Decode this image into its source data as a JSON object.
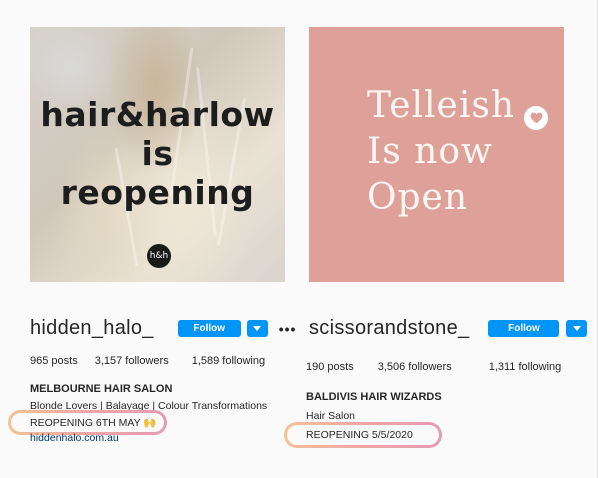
{
  "profiles": [
    {
      "image": {
        "headline_lines": [
          "hair&harlow",
          "is",
          "reopening"
        ],
        "logo_text": "h&h"
      },
      "username": "hidden_halo_",
      "follow_label": "Follow",
      "stats": {
        "posts": "965 posts",
        "followers": "3,157 followers",
        "following": "1,589 following"
      },
      "bio": {
        "name": "MELBOURNE HAIR SALON",
        "category": "Blonde Lovers | Balayage | Colour Transformations",
        "announcement": "REOPENING 6TH MAY 🙌",
        "link": "hiddenhalo.com.au"
      }
    },
    {
      "image": {
        "headline_lines": [
          "Telleish",
          "Is now",
          "Open"
        ],
        "badge_icon": "heart-icon",
        "background_color": "#dea19a"
      },
      "username": "scissorandstone_",
      "follow_label": "Follow",
      "stats": {
        "posts": "190 posts",
        "followers": "3,506 followers",
        "following": "1,311 following"
      },
      "bio": {
        "name": "BALDIVIS HAIR WIZARDS",
        "category": "Hair Salon",
        "announcement": "REOPENING 5/5/2020"
      }
    }
  ],
  "colors": {
    "follow_button": "#0095f6",
    "highlight_gradient": [
      "#f3c295",
      "#f0a5a5",
      "#e59bb4"
    ],
    "link": "#00376b"
  }
}
